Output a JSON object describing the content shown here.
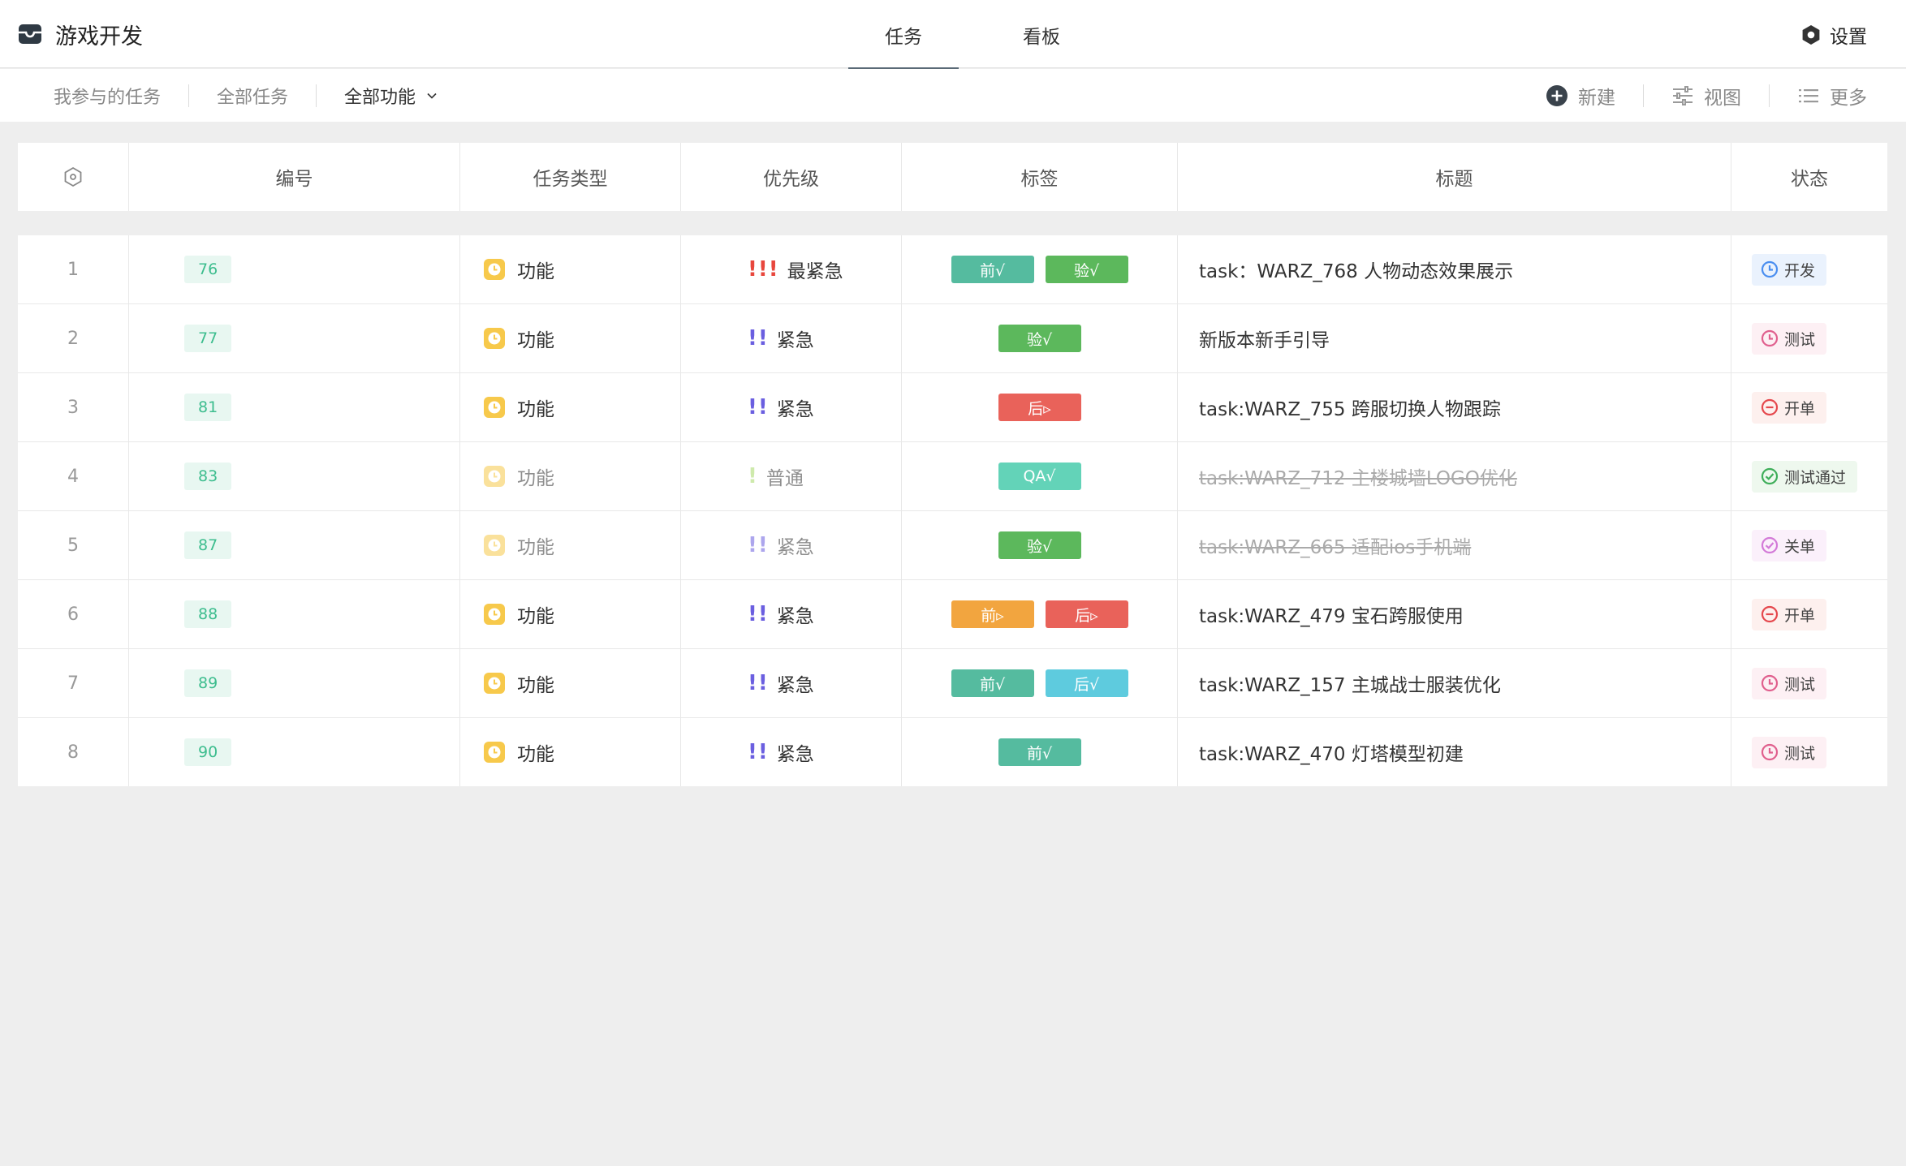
{
  "app": {
    "title": "游戏开发"
  },
  "tabs": [
    {
      "label": "任务",
      "active": true
    },
    {
      "label": "看板",
      "active": false
    }
  ],
  "settings": {
    "label": "设置"
  },
  "filters": [
    {
      "label": "我参与的任务"
    },
    {
      "label": "全部任务"
    },
    {
      "label": "全部功能",
      "dropdown": true
    }
  ],
  "actions": [
    {
      "label": "新建",
      "icon": "plus-circle-icon"
    },
    {
      "label": "视图",
      "icon": "sliders-icon"
    },
    {
      "label": "更多",
      "icon": "list-icon"
    }
  ],
  "columns": [
    "",
    "编号",
    "任务类型",
    "优先级",
    "标签",
    "标题",
    "状态"
  ],
  "colors": {
    "tag_teal": "#55bb9f",
    "tag_green": "#5cb85c",
    "tag_red": "#e9625a",
    "tag_orange": "#f2a53f",
    "tag_cyan": "#5ecbde",
    "tag_mint": "#63d3b8",
    "type_yellow": "#f7c94b"
  },
  "rows": [
    {
      "idx": "1",
      "num": "76",
      "type": "功能",
      "prio_marks": "!!!",
      "prio": "最紧急",
      "prio_color": "#e8473d",
      "tags": [
        {
          "text": "前√",
          "color": "#55bb9f"
        },
        {
          "text": "验√",
          "color": "#5cb85c"
        }
      ],
      "title": "task：WARZ_768 人物动态效果展示",
      "done": false,
      "status": "开发",
      "status_icon": "clock-icon",
      "status_bg": "#eaf2fd",
      "status_color": "#4a8ef0"
    },
    {
      "idx": "2",
      "num": "77",
      "type": "功能",
      "prio_marks": "!!",
      "prio": "紧急",
      "prio_color": "#6b5fe0",
      "tags": [
        {
          "text": "验√",
          "color": "#5cb85c"
        }
      ],
      "title": "新版本新手引导",
      "done": false,
      "status": "测试",
      "status_icon": "clock-icon",
      "status_bg": "#fdf0f4",
      "status_color": "#e0608e"
    },
    {
      "idx": "3",
      "num": "81",
      "type": "功能",
      "prio_marks": "!!",
      "prio": "紧急",
      "prio_color": "#6b5fe0",
      "tags": [
        {
          "text": "后▹",
          "color": "#e9625a"
        }
      ],
      "title": "task:WARZ_755 跨服切换人物跟踪",
      "done": false,
      "status": "开单",
      "status_icon": "minus-circle-icon",
      "status_bg": "#fdf0ee",
      "status_color": "#e5484d"
    },
    {
      "idx": "4",
      "num": "83",
      "type": "功能",
      "prio_marks": "!",
      "prio": "普通",
      "prio_color": "#a7d96a",
      "tags": [
        {
          "text": "QA√",
          "color": "#63d3b8"
        }
      ],
      "title": "task:WARZ_712 主楼城墙LOGO优化",
      "done": true,
      "status": "测试通过",
      "status_icon": "check-circle-icon",
      "status_bg": "#eef8ee",
      "status_color": "#3fae5a"
    },
    {
      "idx": "5",
      "num": "87",
      "type": "功能",
      "prio_marks": "!!",
      "prio": "紧急",
      "prio_color": "#6b5fe0",
      "tags": [
        {
          "text": "验√",
          "color": "#5cb85c"
        }
      ],
      "title": "task:WARZ_665 适配ios手机端",
      "done": true,
      "status": "关单",
      "status_icon": "check-circle-icon",
      "status_bg": "#fbf0fb",
      "status_color": "#d37ad8"
    },
    {
      "idx": "6",
      "num": "88",
      "type": "功能",
      "prio_marks": "!!",
      "prio": "紧急",
      "prio_color": "#6b5fe0",
      "tags": [
        {
          "text": "前▹",
          "color": "#f2a53f"
        },
        {
          "text": "后▹",
          "color": "#e9625a"
        }
      ],
      "title": "task:WARZ_479 宝石跨服使用",
      "done": false,
      "status": "开单",
      "status_icon": "minus-circle-icon",
      "status_bg": "#fdf0ee",
      "status_color": "#e5484d"
    },
    {
      "idx": "7",
      "num": "89",
      "type": "功能",
      "prio_marks": "!!",
      "prio": "紧急",
      "prio_color": "#6b5fe0",
      "tags": [
        {
          "text": "前√",
          "color": "#55bb9f"
        },
        {
          "text": "后√",
          "color": "#5ecbde"
        }
      ],
      "title": "task:WARZ_157 主城战士服装优化",
      "done": false,
      "status": "测试",
      "status_icon": "clock-icon",
      "status_bg": "#fdf0f4",
      "status_color": "#e0608e"
    },
    {
      "idx": "8",
      "num": "90",
      "type": "功能",
      "prio_marks": "!!",
      "prio": "紧急",
      "prio_color": "#6b5fe0",
      "tags": [
        {
          "text": "前√",
          "color": "#55bb9f"
        }
      ],
      "title": "task:WARZ_470 灯塔模型初建",
      "done": false,
      "status": "测试",
      "status_icon": "clock-icon",
      "status_bg": "#fdf0f4",
      "status_color": "#e0608e"
    }
  ]
}
